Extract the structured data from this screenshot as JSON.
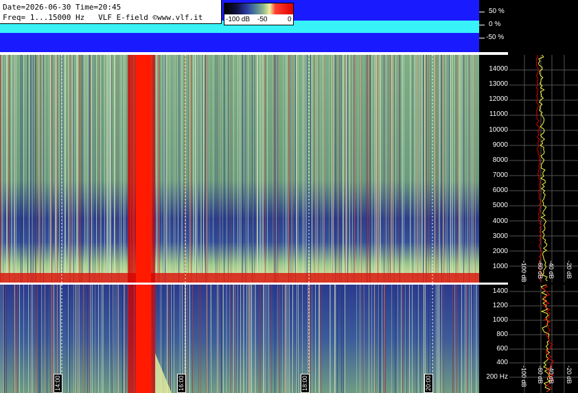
{
  "header": {
    "line1": "Date=2026-06-30 Time=20:45",
    "line2": "Freq= 1...15000 Hz   VLF E-field ©www.vlf.it"
  },
  "scale": {
    "labels": [
      "-100 dB",
      "-50",
      "0"
    ]
  },
  "waveform_axis": {
    "labels": [
      "50 %",
      "0 %",
      "-50 %"
    ]
  },
  "freq_axis_top": {
    "labels": [
      "14000",
      "13000",
      "12000",
      "11000",
      "10000",
      "9000",
      "8000",
      "7000",
      "6000",
      "5000",
      "4000",
      "3000",
      "2000",
      "1000"
    ]
  },
  "freq_axis_bottom": {
    "labels": [
      "1400",
      "1200",
      "1000",
      "800",
      "600",
      "400",
      "200 Hz"
    ]
  },
  "side_panel_top": {
    "db_labels": [
      "-100 dB",
      "-60 dB",
      "-40 dB",
      "-20 dB"
    ]
  },
  "side_panel_bottom": {
    "db_labels": [
      "-100 dB",
      "-60 dB",
      "-40 dB",
      "-20 dB"
    ]
  },
  "time_axis": {
    "labels": [
      "14:00",
      "16:00",
      "18:00",
      "20:00"
    ]
  },
  "colors": {
    "waveform_bg": "#1a1aff",
    "waveform_band": "#38f2f7",
    "spectrum_red": "#e00000",
    "spectrum_green": "#7fb07f",
    "spectrum_blue": "#2a3a9a"
  }
}
